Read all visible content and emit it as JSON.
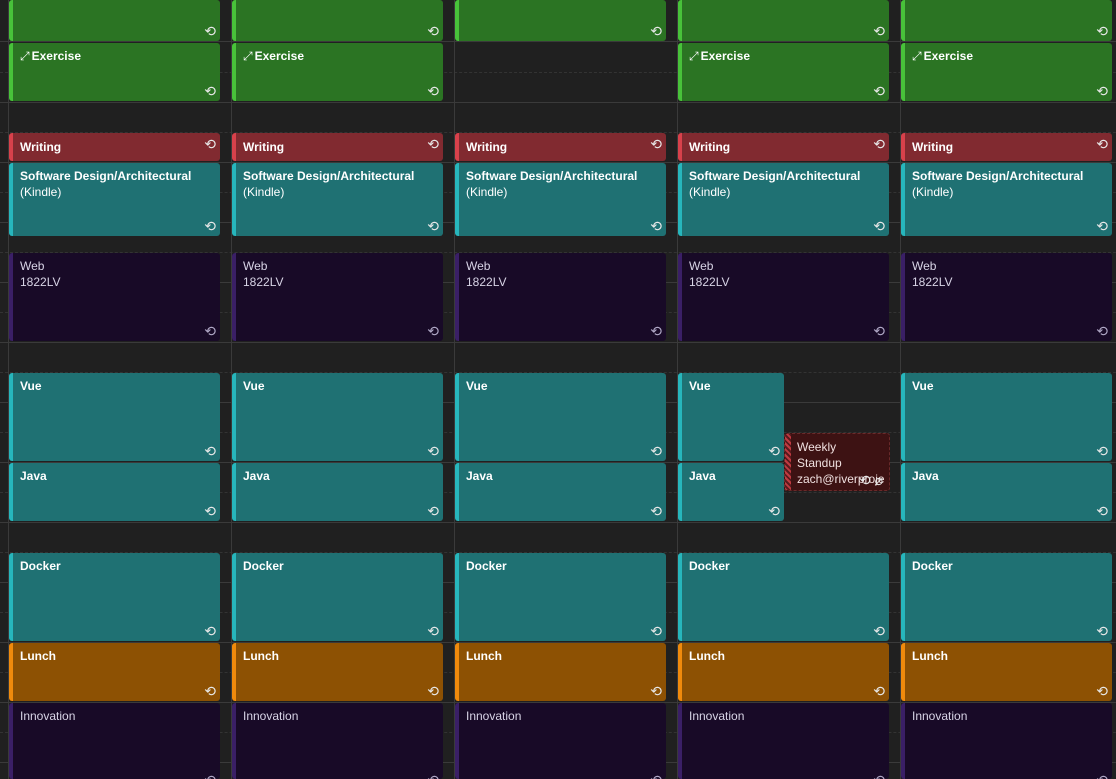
{
  "calendar": {
    "columns": 5,
    "colors": {
      "background": "#202020",
      "exercise": "#2b7423",
      "exercise_bar": "#48c23a",
      "writing": "#812a30",
      "writing_bar": "#d8414b",
      "teal": "#1f7173",
      "teal_bar": "#27b6bc",
      "purple": "#180a27",
      "purple_bar": "#3a1f66",
      "lunch": "#8d5103",
      "lunch_bar": "#f08a0c",
      "standup": "#3d1213"
    },
    "events": {
      "top_block": "",
      "exercise": "Exercise",
      "writing": "Writing",
      "software_design": "Software Design/Architectural",
      "software_design_sub": "(Kindle)",
      "web": "Web",
      "web_sub": "1822LV",
      "vue": "Vue",
      "java": "Java",
      "docker": "Docker",
      "lunch": "Lunch",
      "innovation": "Innovation",
      "standup": "Weekly Standup",
      "standup_sub": "zach@riverproje"
    },
    "icons": {
      "recurring": "recurring-icon",
      "exercise": "expand-arrows-icon",
      "attachment": "paperclip-icon"
    },
    "glyphs": {
      "recurring": "⟲",
      "exercise": "⤢",
      "attachment": "⌀"
    }
  }
}
